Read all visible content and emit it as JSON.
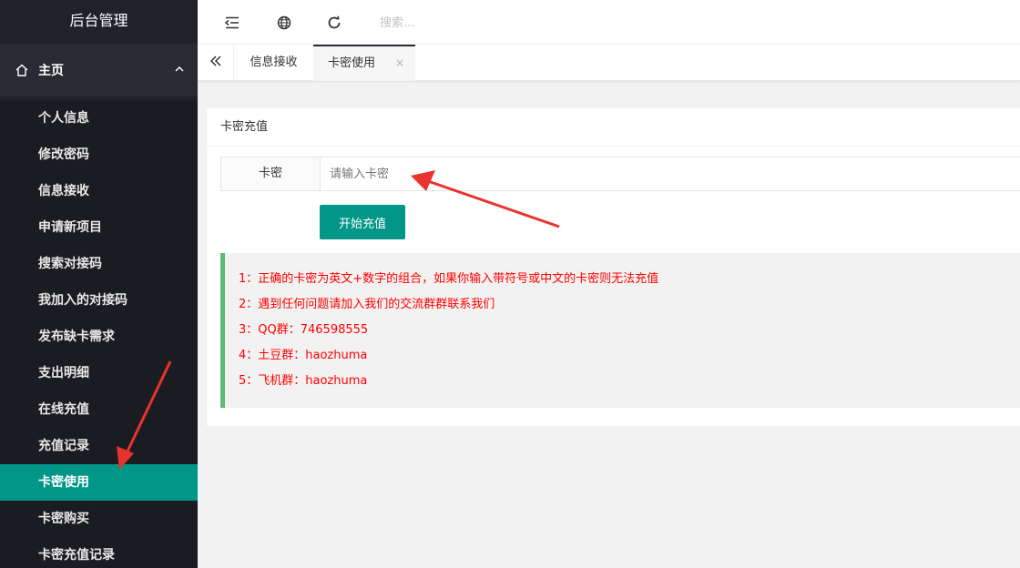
{
  "sidebar": {
    "title": "后台管理",
    "parent": {
      "label": "主页"
    },
    "items": [
      {
        "label": "个人信息"
      },
      {
        "label": "修改密码"
      },
      {
        "label": "信息接收"
      },
      {
        "label": "申请新项目"
      },
      {
        "label": "搜索对接码"
      },
      {
        "label": "我加入的对接码"
      },
      {
        "label": "发布缺卡需求"
      },
      {
        "label": "支出明细"
      },
      {
        "label": "在线充值"
      },
      {
        "label": "充值记录"
      },
      {
        "label": "卡密使用",
        "active": true
      },
      {
        "label": "卡密购买"
      },
      {
        "label": "卡密充值记录"
      }
    ]
  },
  "header": {
    "icons": [
      "menu-fold-icon",
      "globe-icon",
      "refresh-icon"
    ],
    "search_placeholder": "搜索..."
  },
  "tabs": {
    "items": [
      {
        "label": "信息接收"
      },
      {
        "label": "卡密使用",
        "active": true,
        "close": "×"
      }
    ]
  },
  "card": {
    "title": "卡密充值",
    "form": {
      "label": "卡密",
      "input_placeholder": "请输入卡密",
      "input_value": "",
      "submit_label": "开始充值"
    },
    "notice": [
      "1：正确的卡密为英文+数字的组合，如果你输入带符号或中文的卡密则无法充值",
      "2：遇到任何问题请加入我们的交流群群联系我们",
      "3：QQ群：746598555",
      "4：土豆群：haozhuma",
      "5：飞机群：haozhuma"
    ]
  },
  "colors": {
    "sidebar_bg": "#20222a",
    "accent": "#009688",
    "notice_text": "#ff0000",
    "notice_border": "#5fb878",
    "annotation_arrow": "#e8332e"
  }
}
